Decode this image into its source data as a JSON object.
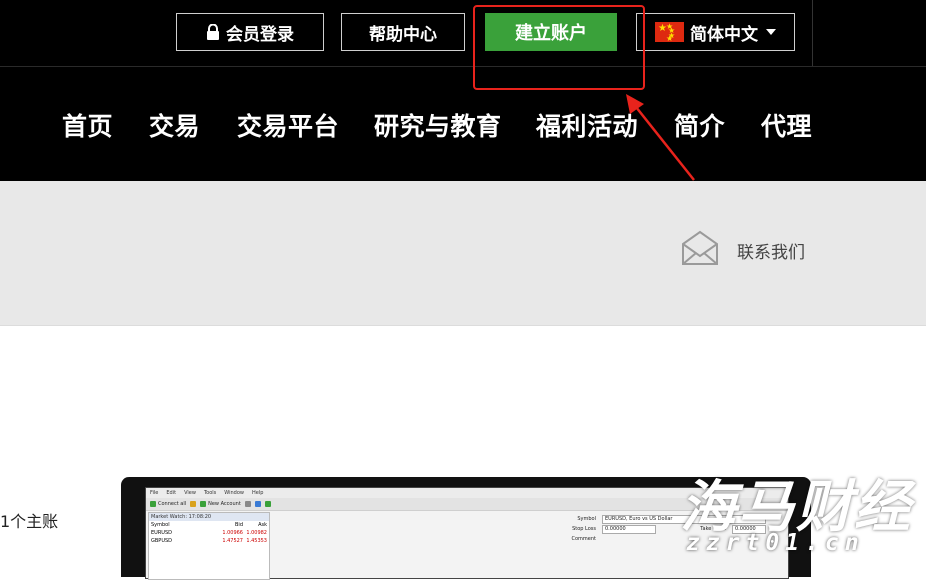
{
  "topbar": {
    "login_label": "会员登录",
    "help_label": "帮助中心",
    "open_account_label": "建立账户",
    "language_label": "简体中文"
  },
  "nav": {
    "items": [
      "首页",
      "交易",
      "交易平台",
      "研究与教育",
      "福利活动",
      "简介",
      "代理"
    ]
  },
  "contact": {
    "label": "联系我们"
  },
  "main": {
    "intro_text": "1个主账"
  },
  "platform": {
    "menu": [
      "File",
      "Edit",
      "View",
      "Tools",
      "Window",
      "Help"
    ],
    "toolbar": [
      "Connect all",
      "New Account"
    ],
    "market_watch_header": "Market Watch: 17:08:20",
    "columns": [
      "Symbol",
      "Bid",
      "Ask"
    ],
    "rows": [
      {
        "symbol": "EURUSD",
        "bid": "1.00966",
        "ask": "1.00982"
      },
      {
        "symbol": "GBPUSD",
        "bid": "1.47527",
        "ask": "1.45353"
      }
    ],
    "order": {
      "symbol_label": "Symbol",
      "symbol_value": "EURUSD, Euro vs US Dollar",
      "stoploss_label": "Stop Loss",
      "stoploss_value": "0.00000",
      "takeprofit_label": "Take Profit",
      "takeprofit_value": "0.00000",
      "comment_label": "Comment"
    }
  },
  "watermark": {
    "title": "海马财经",
    "url": "zzrt01.cn"
  },
  "colors": {
    "accent_green": "#3aa13a",
    "highlight_red": "#e8231c",
    "nav_bg": "#000000",
    "band_bg": "#e8e8e8"
  }
}
